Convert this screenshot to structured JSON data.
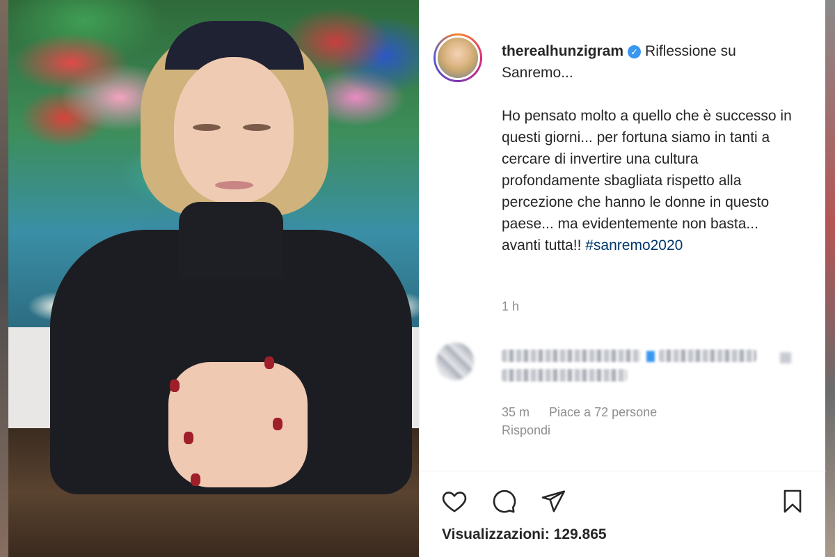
{
  "post": {
    "username": "therealhunzigram",
    "verified_icon": "verified-badge-icon",
    "caption_title": "Riflessione su Sanremo...",
    "caption_body": "Ho pensato molto a quello che è successo in questi giorni... per fortuna siamo in tanti a cercare di invertire una cultura profondamente sbagliata rispetto alla percezione che hanno le donne in questo paese... ma evidentemente non basta... avanti tutta!! ",
    "hashtag": "#sanremo2020",
    "caption_time": "1 h"
  },
  "comment": {
    "time": "35 m",
    "likes": "Piace a 72 persone",
    "reply": "Rispondi"
  },
  "actions": {
    "like_icon": "heart-icon",
    "comment_icon": "comment-icon",
    "share_icon": "paper-plane-icon",
    "save_icon": "bookmark-icon"
  },
  "stats": {
    "views": "Visualizzazioni: 129.865"
  },
  "colors": {
    "link": "#00376b",
    "verified": "#3897f0",
    "muted": "#8e8e8e",
    "text": "#262626"
  }
}
